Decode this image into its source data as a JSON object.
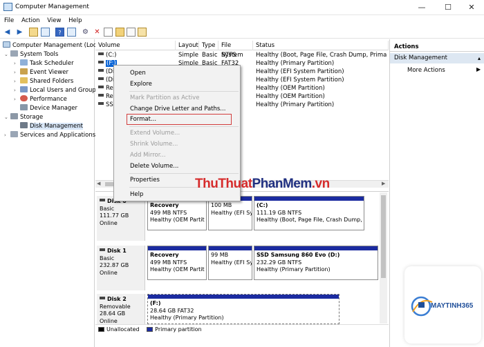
{
  "window": {
    "title": "Computer Management",
    "minimize": "—",
    "maximize": "☐",
    "close": "✕"
  },
  "menubar": [
    "File",
    "Action",
    "View",
    "Help"
  ],
  "tree": {
    "root": "Computer Management (Local",
    "system_tools": "System Tools",
    "task_scheduler": "Task Scheduler",
    "event_viewer": "Event Viewer",
    "shared_folders": "Shared Folders",
    "local_users": "Local Users and Groups",
    "performance": "Performance",
    "device_manager": "Device Manager",
    "storage": "Storage",
    "disk_management": "Disk Management",
    "services": "Services and Applications"
  },
  "volumes": {
    "headers": [
      "Volume",
      "Layout",
      "Type",
      "File System",
      "Status"
    ],
    "rows": [
      {
        "volume": "(C:)",
        "layout": "Simple",
        "type": "Basic",
        "fs": "NTFS",
        "status": "Healthy (Boot, Page File, Crash Dump, Primary Part"
      },
      {
        "volume": "(F:)",
        "layout": "Simple",
        "type": "Basic",
        "fs": "FAT32",
        "status": "Healthy (Primary Partition)"
      },
      {
        "volume": "(Di",
        "layout": "",
        "type": "",
        "fs": "",
        "status": "Healthy (EFI System Partition)"
      },
      {
        "volume": "(Di",
        "layout": "",
        "type": "",
        "fs": "",
        "status": "Healthy (EFI System Partition)"
      },
      {
        "volume": "Re",
        "layout": "",
        "type": "",
        "fs": "",
        "status": "Healthy (OEM Partition)"
      },
      {
        "volume": "Re",
        "layout": "",
        "type": "",
        "fs": "",
        "status": "Healthy (OEM Partition)"
      },
      {
        "volume": "SSI",
        "layout": "",
        "type": "",
        "fs": "",
        "status": "Healthy (Primary Partition)"
      }
    ]
  },
  "disks": {
    "disk0": {
      "name": "Disk 0",
      "type": "Basic",
      "size": "111.77 GB",
      "state": "Online",
      "parts": [
        {
          "title": "Recovery",
          "size": "499 MB NTFS",
          "status": "Healthy (OEM Partit"
        },
        {
          "title": "",
          "size": "100 MB",
          "status": "Healthy (EFI Sy"
        },
        {
          "title": "(C:)",
          "size": "111.19 GB NTFS",
          "status": "Healthy (Boot, Page File, Crash Dump, Pr"
        }
      ]
    },
    "disk1": {
      "name": "Disk 1",
      "type": "Basic",
      "size": "232.87 GB",
      "state": "Online",
      "parts": [
        {
          "title": "Recovery",
          "size": "499 MB NTFS",
          "status": "Healthy (OEM Partit"
        },
        {
          "title": "",
          "size": "99 MB",
          "status": "Healthy (EFI Sy"
        },
        {
          "title": "SSD Samsung 860 Evo  (D:)",
          "size": "232.29 GB NTFS",
          "status": "Healthy (Primary Partition)"
        }
      ]
    },
    "disk2": {
      "name": "Disk 2",
      "type": "Removable",
      "size": "28.64 GB",
      "state": "Online",
      "parts": [
        {
          "title": "(F:)",
          "size": "28.64 GB FAT32",
          "status": "Healthy (Primary Partition)"
        }
      ]
    }
  },
  "legend": {
    "unallocated": "Unallocated",
    "primary": "Primary partition"
  },
  "actions": {
    "header": "Actions",
    "section": "Disk Management",
    "more": "More Actions"
  },
  "context_menu": {
    "open": "Open",
    "explore": "Explore",
    "mark_active": "Mark Partition as Active",
    "change_letter": "Change Drive Letter and Paths...",
    "format": "Format...",
    "extend": "Extend Volume...",
    "shrink": "Shrink Volume...",
    "add_mirror": "Add Mirror...",
    "delete": "Delete Volume...",
    "properties": "Properties",
    "help": "Help"
  },
  "watermark": {
    "part1": "ThuThuat",
    "part2": "PhanMem",
    "part3": ".vn"
  },
  "logo": {
    "name": "MAYTINH365"
  },
  "colors": {
    "partition_bar": "#1b2ba0",
    "format_highlight": "#d23c3c",
    "watermark_red": "#d62b2b",
    "watermark_dark": "#1f2f80"
  }
}
